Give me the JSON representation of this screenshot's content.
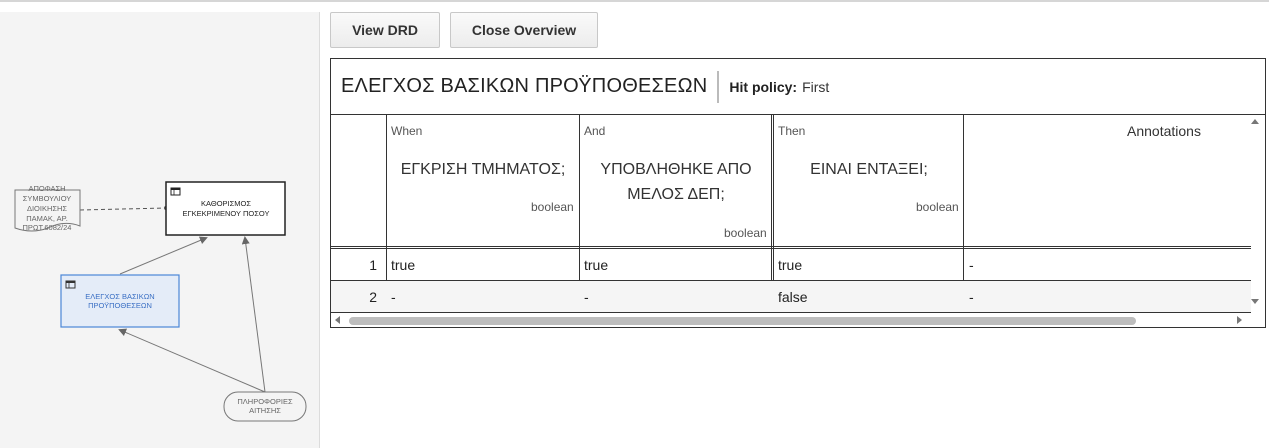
{
  "toolbar": {
    "view_drd_label": "View DRD",
    "close_overview_label": "Close Overview"
  },
  "drd": {
    "nodes": {
      "knowledge_line1": "ΑΠΟΦΑΣΗ",
      "knowledge_line2": "ΣΥΜΒΟΥΛΙΟΥ",
      "knowledge_line3": "ΔΙΟΙΚΗΣΗΣ",
      "knowledge_line4": "ΠΑΜΑΚ, ΑΡ.",
      "knowledge_line5": "ΠΡΩΤ.6082/24",
      "decision_amount_line1": "ΚΑΘΟΡΙΣΜΟΣ",
      "decision_amount_line2": "ΕΓΚΕΚΡΙΜΕΝΟΥ ΠΟΣΟΥ",
      "decision_check_line1": "ΕΛΕΓΧΟΣ ΒΑΣΙΚΩΝ",
      "decision_check_line2": "ΠΡΟΫΠΟΘΕΣΕΩΝ",
      "input_line1": "ΠΛΗΡΟΦΟΡΙΕΣ",
      "input_line2": "ΑΙΤΗΣΗΣ"
    },
    "colors": {
      "selected_fill": "#e4ecf8",
      "selected_stroke": "#4a87d8",
      "selected_text": "#3a6fc4"
    }
  },
  "table": {
    "name": "ΕΛΕΓΧΟΣ ΒΑΣΙΚΩΝ ΠΡΟΫΠΟΘΕΣΕΩΝ",
    "hit_policy_label": "Hit policy:",
    "hit_policy_value": "First",
    "inputs": [
      {
        "clause_label": "When",
        "name": "ΕΓΚΡΙΣΗ ΤΜΗΜΑΤΟΣ;",
        "type": "boolean"
      },
      {
        "clause_label": "And",
        "name_line1": "ΥΠΟΒΛΗΘΗΚΕ ΑΠΟ",
        "name_line2": "ΜΕΛΟΣ ΔΕΠ;",
        "type": "boolean"
      }
    ],
    "output": {
      "clause_label": "Then",
      "name": "ΕΙΝΑΙ ΕΝΤΑΞΕΙ;",
      "type": "boolean"
    },
    "annotations_header": "Annotations",
    "rules": [
      {
        "index": "1",
        "cells": [
          "true",
          "true",
          "true",
          "-"
        ]
      },
      {
        "index": "2",
        "cells": [
          "-",
          "-",
          "false",
          "-"
        ]
      }
    ]
  }
}
